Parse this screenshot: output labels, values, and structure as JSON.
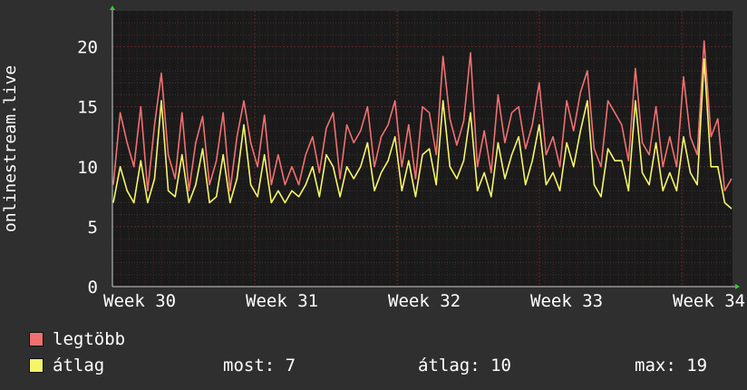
{
  "chart_data": {
    "type": "line",
    "ylabel": "onlinestream.live",
    "ylim": [
      0,
      23
    ],
    "yticks": [
      0,
      5,
      10,
      15,
      20
    ],
    "x_tick_labels": [
      "Week 30",
      "Week 31",
      "Week 32",
      "Week 33",
      "Week 34"
    ],
    "grid": true,
    "colors": {
      "background": "#2f2f2f",
      "plot_bg": "#1a1a1a",
      "grid": "#4a4a4a",
      "minor_vgrid": "#7a2a2a",
      "axis": "#cccccc"
    },
    "series": [
      {
        "name": "legtöbb",
        "color": "#f07070",
        "values": [
          8.5,
          14.5,
          12,
          10,
          15,
          8,
          13.5,
          17.8,
          11,
          9,
          14.5,
          8,
          12,
          14.2,
          8.5,
          10.5,
          14.5,
          8,
          12.5,
          15.5,
          12,
          10,
          14.3,
          8.5,
          11,
          8.5,
          10,
          8.5,
          11,
          12.5,
          9.5,
          13.2,
          14.5,
          9,
          13.5,
          12,
          13,
          15,
          10,
          12.5,
          13.5,
          15.5,
          10,
          13.5,
          9,
          15,
          14.5,
          11,
          19.2,
          14,
          11.8,
          13.8,
          19.5,
          10,
          13,
          9.5,
          16,
          12,
          14.5,
          15,
          11.5,
          13.5,
          17,
          11,
          12.5,
          10,
          15.5,
          13,
          16.2,
          18,
          11.5,
          10,
          15.5,
          14.5,
          13.5,
          10.5,
          18.2,
          12,
          11,
          15,
          10,
          12.5,
          10,
          17.5,
          12.5,
          11,
          20.5,
          12.5,
          14,
          8,
          9
        ]
      },
      {
        "name": "átlag",
        "color": "#f5f56a",
        "values": [
          7,
          10,
          8,
          7,
          10.5,
          7,
          9,
          15.5,
          8,
          7.5,
          11,
          7,
          8.5,
          11.5,
          7,
          7.5,
          11,
          7,
          9,
          13.5,
          8.5,
          7.5,
          11,
          7,
          8,
          7,
          8,
          7.5,
          8.5,
          10,
          7.5,
          11,
          10,
          7.5,
          10,
          9,
          10,
          12,
          8,
          9.5,
          10.5,
          12.5,
          8,
          10.5,
          7.5,
          11,
          11.5,
          8.5,
          15.5,
          10,
          9,
          10.5,
          14.5,
          8,
          9.5,
          7.5,
          12,
          9,
          11,
          12.5,
          8.5,
          10.5,
          13.5,
          8.5,
          9.5,
          8,
          12,
          10,
          13,
          15.5,
          8.5,
          7.5,
          11.5,
          10.5,
          10.5,
          8,
          15.5,
          9.5,
          8.5,
          12,
          8,
          9.5,
          8,
          12.5,
          9.5,
          8.5,
          19,
          10,
          10,
          7,
          6.5
        ]
      }
    ]
  },
  "legend": [
    {
      "label": "legtöbb",
      "color": "#f07070"
    },
    {
      "label": "átlag",
      "color": "#f5f56a"
    }
  ],
  "stats": {
    "most": "most: 7",
    "atlag": "átlag: 10",
    "max": "max: 19"
  }
}
